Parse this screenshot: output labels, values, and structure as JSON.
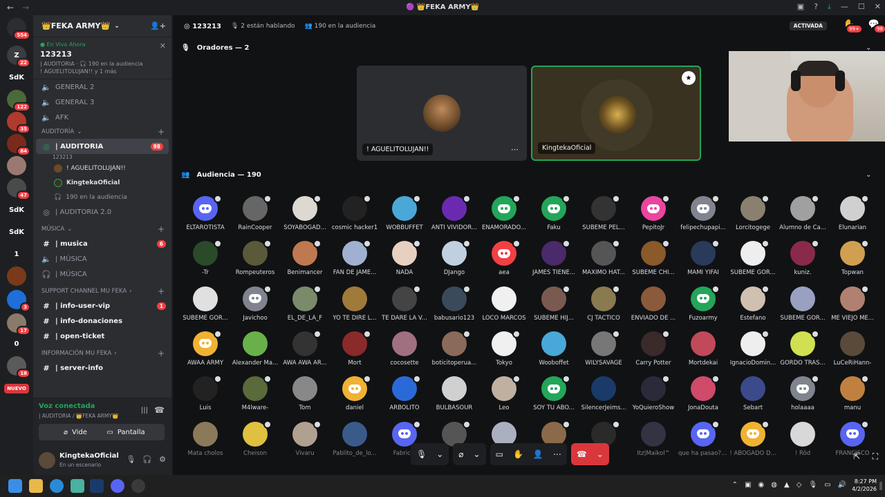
{
  "window": {
    "title": "🟣 👑FEKA ARMY👑"
  },
  "servers": [
    {
      "label": "",
      "badge": "554",
      "color": "#2b2d31"
    },
    {
      "label": "Z",
      "badge": "22",
      "color": "#3a3c42"
    },
    {
      "label": "SdK",
      "badge": "",
      "color": "#1e1f22"
    },
    {
      "label": "",
      "badge": "122",
      "color": "#4a6a3a"
    },
    {
      "label": "",
      "badge": "35",
      "color": "#b03a2e"
    },
    {
      "label": "",
      "badge": "84",
      "color": "#7a2a1a"
    },
    {
      "label": "",
      "badge": "",
      "color": "#9a7a70"
    },
    {
      "label": "",
      "badge": "47",
      "color": "#4a4a4a"
    },
    {
      "label": "SdK",
      "badge": "",
      "color": "#1e1f22"
    },
    {
      "label": "SdK",
      "badge": "",
      "color": "#1e1f22"
    },
    {
      "label": "1",
      "badge": "",
      "color": "#1e1f22"
    },
    {
      "label": "",
      "badge": "",
      "color": "#7a3a1a"
    },
    {
      "label": "",
      "badge": "3",
      "color": "#1e6fd9"
    },
    {
      "label": "",
      "badge": "17",
      "color": "#8a7a6a"
    },
    {
      "label": "0",
      "badge": "",
      "color": "#1e1f22"
    },
    {
      "label": "",
      "badge": "18",
      "color": "#5a5a5a"
    },
    {
      "label": "NUEVO",
      "badge": "",
      "color": "#da373c"
    }
  ],
  "sidebar": {
    "guild_name": "👑FEKA ARMY👑",
    "live": {
      "label": "En Vivo Ahora",
      "stage": "123213",
      "meta": "| AUDITORIA · 🎧 190 en la audiencia",
      "people": "! AGUELITOLUJAN!! y 1 más"
    },
    "channels_top": [
      "GENERAL 2",
      "GENERAL 3",
      "AFK"
    ],
    "cat_auditoria": "AUDITORÍA",
    "auditoria": {
      "name": "| AUDITORIA",
      "topic": "123213",
      "badge": "98"
    },
    "speakers": [
      "! AGUELITOLUJAN!!",
      "KingtekaOficial"
    ],
    "audience_count": "190 en la audiencia",
    "auditoria2": "| AUDITORIA 2.0",
    "cat_musica": "MÚSICA",
    "musica": [
      {
        "name": "| musica",
        "badge": "6"
      },
      {
        "name": "| MÚSICA",
        "badge": ""
      },
      {
        "name": "| MÚSICA",
        "badge": ""
      }
    ],
    "cat_support": "SUPPORT CHANNEL MU FEKA",
    "support": [
      {
        "name": "| info-user-vip",
        "badge": "1"
      },
      {
        "name": "| info-donaciones",
        "badge": ""
      },
      {
        "name": "| open-ticket",
        "badge": ""
      }
    ],
    "cat_info": "INFORMACIÓN MU FEKA",
    "info": [
      {
        "name": "| server-info",
        "badge": ""
      }
    ]
  },
  "voice_panel": {
    "status": "Voz conectada",
    "location": "| AUDITORIA / 👑FEKA ARMY👑",
    "video_label": "Video",
    "screen_label": "Pantalla",
    "user_name": "KingtekaOficial",
    "user_status": "En un escenario"
  },
  "stage_header": {
    "stage_name": "123213",
    "speaking": "2 están hablando",
    "audience": "190 en la audiencia",
    "activated": "ACTIVADA",
    "hand_badge": "99+",
    "other_badge": "98"
  },
  "speakers_section": {
    "title": "Oradores — 2"
  },
  "speakers": [
    {
      "name": "! AGUELITOLUJAN!!",
      "color": "#6b4a2a"
    },
    {
      "name": "KingtekaOficial",
      "color": "#3a3220"
    }
  ],
  "audience_section": {
    "title": "Audiencia — 190"
  },
  "audience": [
    {
      "name": "ELTAROTISTA",
      "color": "#5865f2",
      "icon": "discord"
    },
    {
      "name": "RainCooper",
      "color": "#666666",
      "icon": ""
    },
    {
      "name": "SOYABOGAD...",
      "color": "#ddd8d0",
      "icon": ""
    },
    {
      "name": "cosmic hacker1",
      "color": "#222222",
      "icon": ""
    },
    {
      "name": "WOBBUFFET",
      "color": "#4aa8d8",
      "icon": ""
    },
    {
      "name": "ANTI VIVIDOR...",
      "color": "#6a2ab0",
      "icon": ""
    },
    {
      "name": "ENAMORADO...",
      "color": "#23a55a",
      "icon": "discord"
    },
    {
      "name": "Faku",
      "color": "#23a55a",
      "icon": "discord"
    },
    {
      "name": "SUBEME PEL...",
      "color": "#333333",
      "icon": ""
    },
    {
      "name": "PepitoJr",
      "color": "#eb459e",
      "icon": "discord"
    },
    {
      "name": "felipechupapi...",
      "color": "#80848e",
      "icon": "discord"
    },
    {
      "name": "Lorcitogege",
      "color": "#8a8070",
      "icon": ""
    },
    {
      "name": "Alumno de Ca...",
      "color": "#a0a0a0",
      "icon": ""
    },
    {
      "name": "Elunarian",
      "color": "#d0d0d0",
      "icon": ""
    },
    {
      "name": "-Tr",
      "color": "#2a4a2a",
      "icon": ""
    },
    {
      "name": "Rompeuteros",
      "color": "#5a5a3a",
      "icon": ""
    },
    {
      "name": "Benimancer",
      "color": "#c07850",
      "icon": ""
    },
    {
      "name": "FAN DE JAME...",
      "color": "#a0b0d0",
      "icon": ""
    },
    {
      "name": "ÑADA",
      "color": "#e8d0c0",
      "icon": ""
    },
    {
      "name": "DJango",
      "color": "#c0d0e0",
      "icon": ""
    },
    {
      "name": "aea",
      "color": "#f23f43",
      "icon": "discord"
    },
    {
      "name": "JAMES TIENE...",
      "color": "#4a2a6a",
      "icon": ""
    },
    {
      "name": "MAXIMO HAT...",
      "color": "#555555",
      "icon": ""
    },
    {
      "name": "SUBEME CHI...",
      "color": "#8a5a2a",
      "icon": ""
    },
    {
      "name": "MAMI YIFAI",
      "color": "#2a3a5a",
      "icon": ""
    },
    {
      "name": "SUBEME GOR...",
      "color": "#eeeeee",
      "icon": ""
    },
    {
      "name": "kuniz.",
      "color": "#8a2a4a",
      "icon": ""
    },
    {
      "name": "Topwan",
      "color": "#d0a050",
      "icon": ""
    },
    {
      "name": "SUBEME GOR...",
      "color": "#e0e0e0",
      "icon": ""
    },
    {
      "name": "Javichoo",
      "color": "#80848e",
      "icon": "discord"
    },
    {
      "name": "EL_DE_LA_F",
      "color": "#7a8a6a",
      "icon": ""
    },
    {
      "name": "YO TE DIRÉ L...",
      "color": "#a07a3a",
      "icon": ""
    },
    {
      "name": "TE DARE LA V...",
      "color": "#444444",
      "icon": ""
    },
    {
      "name": "babusario123",
      "color": "#3a4a5a",
      "icon": ""
    },
    {
      "name": "LOCO MARCOS",
      "color": "#f0f0f0",
      "icon": ""
    },
    {
      "name": "SUBEME HIJ...",
      "color": "#7a5a50",
      "icon": ""
    },
    {
      "name": "CJ TACTICO",
      "color": "#8a7a50",
      "icon": ""
    },
    {
      "name": "ENVIADO DE ...",
      "color": "#8a5a3a",
      "icon": ""
    },
    {
      "name": "Fuzoarmy",
      "color": "#23a55a",
      "icon": "discord"
    },
    {
      "name": "Estefano",
      "color": "#d0c0b0",
      "icon": ""
    },
    {
      "name": "SUBEME GOR...",
      "color": "#9aa0c0",
      "icon": ""
    },
    {
      "name": "ME VIEJO ME...",
      "color": "#b08070",
      "icon": ""
    },
    {
      "name": "AWAA ARMY",
      "color": "#f0b232",
      "icon": "discord"
    },
    {
      "name": "Alexander Ma...",
      "color": "#6ab04a",
      "icon": ""
    },
    {
      "name": "AWA AWA AR...",
      "color": "#333333",
      "icon": ""
    },
    {
      "name": "Mort",
      "color": "#8a2a2a",
      "icon": ""
    },
    {
      "name": "cocosette",
      "color": "#a07080",
      "icon": ""
    },
    {
      "name": "boticitoperua...",
      "color": "#8a6a5a",
      "icon": ""
    },
    {
      "name": "Tokyo",
      "color": "#f0f0f0",
      "icon": ""
    },
    {
      "name": "Wooboffet",
      "color": "#4aa8d8",
      "icon": ""
    },
    {
      "name": "WILYSAVAGE",
      "color": "#777777",
      "icon": ""
    },
    {
      "name": "Carry Potter",
      "color": "#3a2a2a",
      "icon": ""
    },
    {
      "name": "Mortdekai",
      "color": "#c04a5a",
      "icon": ""
    },
    {
      "name": "IgnacioDomin...",
      "color": "#eeeeee",
      "icon": ""
    },
    {
      "name": "GORDO TRAS...",
      "color": "#d0e050",
      "icon": ""
    },
    {
      "name": "LuCeRiHann-",
      "color": "#5a4a3a",
      "icon": ""
    },
    {
      "name": "Luis",
      "color": "#222222",
      "icon": ""
    },
    {
      "name": "M4lware-",
      "color": "#5a6a3a",
      "icon": ""
    },
    {
      "name": "Tom",
      "color": "#888888",
      "icon": ""
    },
    {
      "name": "daniel",
      "color": "#f0b232",
      "icon": "discord"
    },
    {
      "name": "ARBOLITO",
      "color": "#2a6ad8",
      "icon": ""
    },
    {
      "name": "BULBASOUR",
      "color": "#d0d0d0",
      "icon": ""
    },
    {
      "name": "Leo",
      "color": "#c0b0a0",
      "icon": ""
    },
    {
      "name": "SOY TU ABO...",
      "color": "#23a55a",
      "icon": "discord"
    },
    {
      "name": "SilencerJeims...",
      "color": "#1a3a6a",
      "icon": ""
    },
    {
      "name": "YoQuieroShow",
      "color": "#2a2a3a",
      "icon": ""
    },
    {
      "name": "JonaDouta",
      "color": "#d04a6a",
      "icon": ""
    },
    {
      "name": "Sebart",
      "color": "#3a4a8a",
      "icon": ""
    },
    {
      "name": "holaaaa",
      "color": "#80848e",
      "icon": "discord"
    },
    {
      "name": "manu",
      "color": "#c08040",
      "icon": ""
    },
    {
      "name": "Mata cholos",
      "color": "#8a7a5a",
      "icon": ""
    },
    {
      "name": "Cheison",
      "color": "#e0c040",
      "icon": ""
    },
    {
      "name": "Vivaru",
      "color": "#b0a090",
      "icon": ""
    },
    {
      "name": "Pablito_de_lo...",
      "color": "#3a5a8a",
      "icon": ""
    },
    {
      "name": "Fabricio",
      "color": "#5865f2",
      "icon": "discord"
    },
    {
      "name": "",
      "color": "#555555",
      "icon": ""
    },
    {
      "name": "",
      "color": "#aab0c0",
      "icon": ""
    },
    {
      "name": "",
      "color": "#8a6a4a",
      "icon": ""
    },
    {
      "name": "dz",
      "color": "#2a2a2a",
      "icon": ""
    },
    {
      "name": "Itz|Maikol^",
      "color": "#333344",
      "icon": ""
    },
    {
      "name": "que ha pasao?!!!",
      "color": "#5865f2",
      "icon": "discord"
    },
    {
      "name": "! ABOGADO D...",
      "color": "#f0b232",
      "icon": "discord"
    },
    {
      "name": "! Röd",
      "color": "#d8d8d8",
      "icon": ""
    },
    {
      "name": "FRANCISCO",
      "color": "#5865f2",
      "icon": "discord"
    }
  ],
  "taskbar": {
    "time": "8:27 PM",
    "date": "4/2/2026"
  }
}
